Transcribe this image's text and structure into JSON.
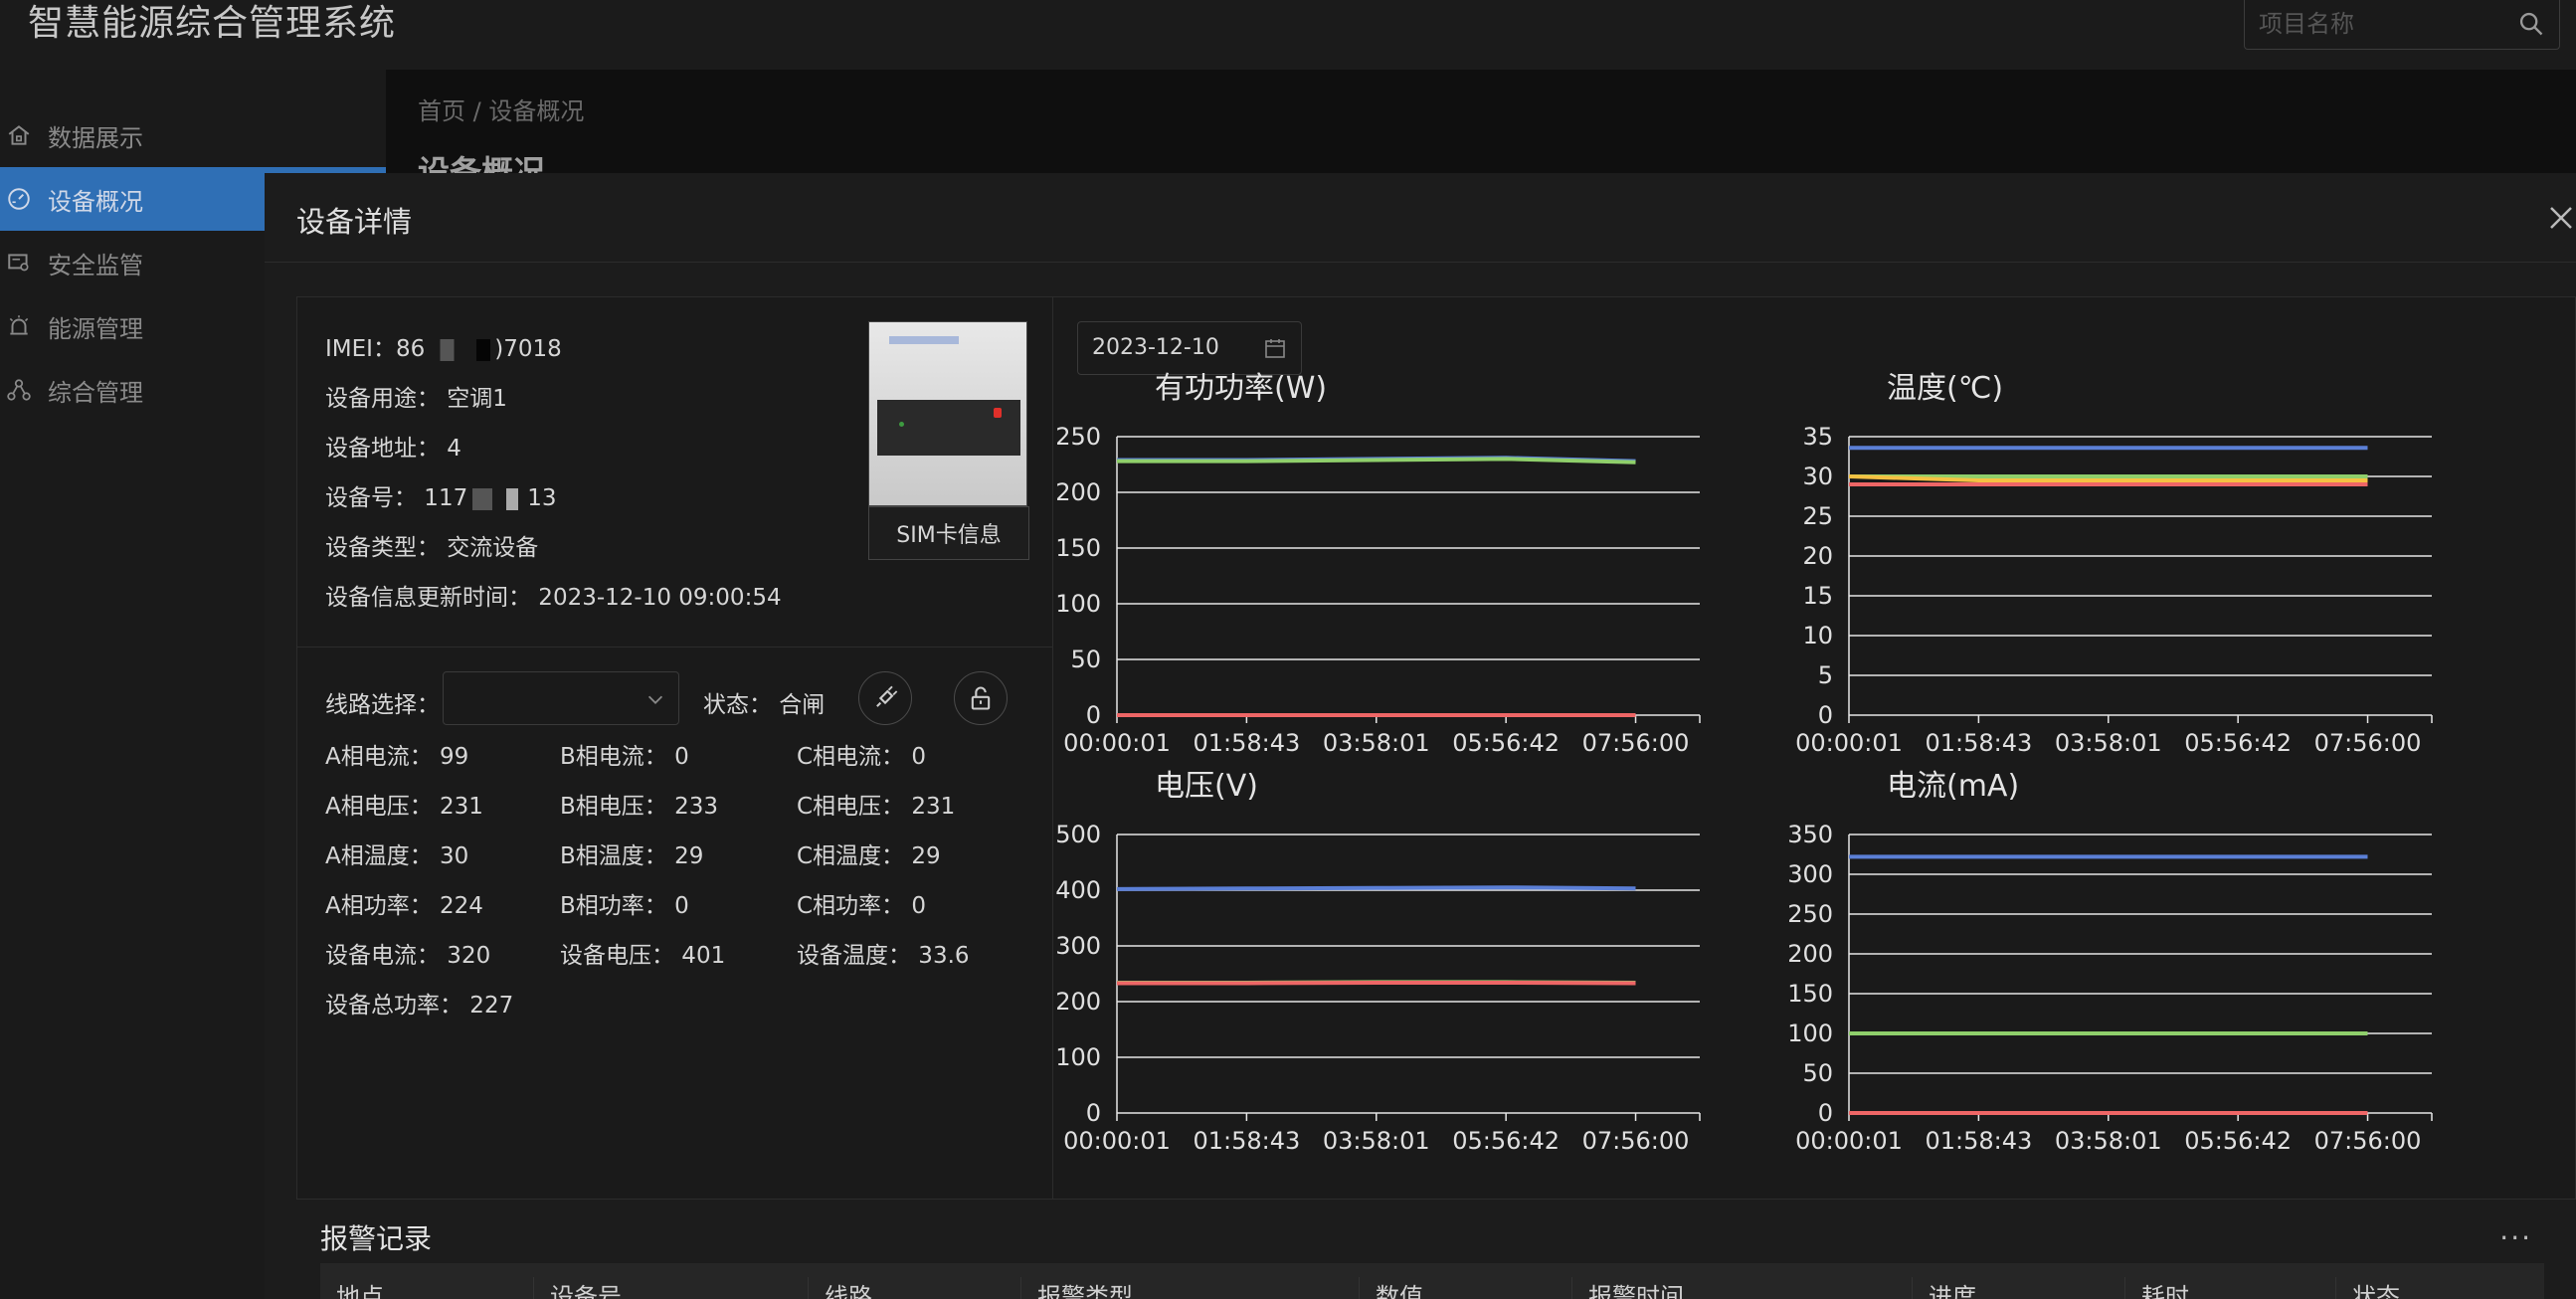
{
  "app": {
    "title": "智慧能源综合管理系统"
  },
  "search": {
    "placeholder": "项目名称"
  },
  "sidebar": {
    "items": [
      {
        "label": "数据展示",
        "icon": "home-icon"
      },
      {
        "label": "设备概况",
        "icon": "dashboard-icon",
        "active": true
      },
      {
        "label": "安全监管",
        "icon": "monitor-icon"
      },
      {
        "label": "能源管理",
        "icon": "alarm-lamp-icon"
      },
      {
        "label": "综合管理",
        "icon": "network-icon"
      }
    ]
  },
  "breadcrumb": {
    "home": "首页",
    "separator": "/",
    "current": "设备概况"
  },
  "page": {
    "title": "设备概况"
  },
  "modal": {
    "title": "设备详情",
    "info": {
      "imei": "IMEI：86",
      "imei_end": ")7018",
      "usage": "设备用途：  空调1",
      "address": "设备地址：  4",
      "number_prefix": "设备号：  117",
      "number_suffix": "13",
      "type": "设备类型：  交流设备",
      "update_time": "设备信息更新时间：  2023-12-10 09:00:54"
    },
    "sim_button": "SIM卡信息",
    "line_select_label": "线路选择：",
    "status": "状态：  合闸",
    "metrics": [
      [
        "A相电流：  99",
        "B相电流：  0",
        "C相电流：  0"
      ],
      [
        "A相电压：  231",
        "B相电压：  233",
        "C相电压：  231"
      ],
      [
        "A相温度：  30",
        "B相温度：  29",
        "C相温度：  29"
      ],
      [
        "A相功率：  224",
        "B相功率：  0",
        "C相功率：  0"
      ],
      [
        "设备电流：  320",
        "设备电压：  401",
        "设备温度：  33.6"
      ],
      [
        "设备总功率：  227"
      ]
    ],
    "date": "2023-12-10"
  },
  "colors": {
    "blue": "#5b7fd6",
    "green": "#8fcf6b",
    "red": "#ee6666",
    "yellow": "#f5c142",
    "accent": "#2f6fb5"
  },
  "chart_data": [
    {
      "type": "line",
      "title": "有功功率(W)",
      "x": [
        "00:00:01",
        "01:58:43",
        "03:58:01",
        "05:56:42",
        "07:56:00"
      ],
      "ylim": [
        0,
        250
      ],
      "yticks": [
        0,
        50,
        100,
        150,
        200,
        250
      ],
      "series": [
        {
          "color": "#5b7fd6",
          "values": [
            229,
            229,
            230,
            231,
            228
          ]
        },
        {
          "color": "#8fcf6b",
          "values": [
            228,
            228,
            229,
            230,
            227
          ]
        },
        {
          "color": "#ee6666",
          "values": [
            0,
            0,
            0,
            0,
            0
          ]
        }
      ],
      "grid": true
    },
    {
      "type": "line",
      "title": "温度(℃)",
      "x": [
        "00:00:01",
        "01:58:43",
        "03:58:01",
        "05:56:42",
        "07:56:00"
      ],
      "ylim": [
        0,
        35
      ],
      "yticks": [
        0,
        5,
        10,
        15,
        20,
        25,
        30,
        35
      ],
      "series": [
        {
          "color": "#5b7fd6",
          "values": [
            33.6,
            33.6,
            33.6,
            33.6,
            33.6
          ]
        },
        {
          "color": "#8fcf6b",
          "values": [
            30,
            30,
            30,
            30,
            30
          ]
        },
        {
          "color": "#f5c142",
          "values": [
            30,
            29.5,
            29.5,
            29.5,
            29.5
          ]
        },
        {
          "color": "#ee6666",
          "values": [
            29,
            29,
            29,
            29,
            29
          ]
        }
      ],
      "grid": true
    },
    {
      "type": "line",
      "title": "电压(V)",
      "x": [
        "00:00:01",
        "01:58:43",
        "03:58:01",
        "05:56:42",
        "07:56:00"
      ],
      "ylim": [
        0,
        500
      ],
      "yticks": [
        0,
        100,
        200,
        300,
        400,
        500
      ],
      "series": [
        {
          "color": "#5b7fd6",
          "values": [
            402,
            403,
            404,
            405,
            403
          ]
        },
        {
          "color": "#8fcf6b",
          "values": [
            234,
            234,
            235,
            235,
            234
          ]
        },
        {
          "color": "#ee6666",
          "values": [
            233,
            233,
            234,
            234,
            233
          ]
        }
      ],
      "grid": true
    },
    {
      "type": "line",
      "title": "电流(mA)",
      "x": [
        "00:00:01",
        "01:58:43",
        "03:58:01",
        "05:56:42",
        "07:56:00"
      ],
      "ylim": [
        0,
        350
      ],
      "yticks": [
        0,
        50,
        100,
        150,
        200,
        250,
        300,
        350
      ],
      "series": [
        {
          "color": "#5b7fd6",
          "values": [
            322,
            322,
            322,
            322,
            322
          ]
        },
        {
          "color": "#8fcf6b",
          "values": [
            100,
            100,
            100,
            100,
            100
          ]
        },
        {
          "color": "#ee6666",
          "values": [
            0,
            0,
            0,
            0,
            0
          ]
        }
      ],
      "grid": true
    }
  ],
  "alarm": {
    "title": "报警记录",
    "more": "···",
    "columns": [
      "地点",
      "设备号",
      "线路",
      "报警类型",
      "数值",
      "报警时间",
      "进度",
      "耗时",
      "状态"
    ]
  }
}
